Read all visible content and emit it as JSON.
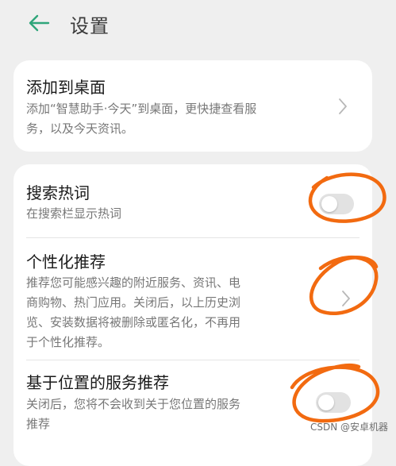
{
  "header": {
    "title": "设置"
  },
  "add_to_desktop": {
    "title": "添加到桌面",
    "desc_line1": "添加“智慧助手·今天”到桌面，更快捷查看服",
    "desc_line2": "务，以及今天资讯。"
  },
  "search_hotwords": {
    "title": "搜索热词",
    "desc": "在搜索栏显示热词",
    "enabled": false
  },
  "personalized": {
    "title": "个性化推荐",
    "desc_line1": "推荐您可能感兴趣的附近服务、资讯、电",
    "desc_line2": "商购物、热门应用。关闭后，以上历史浏",
    "desc_line3": "览、安装数据将被删除或匿名化，不再用",
    "desc_line4": "于个性化推荐。"
  },
  "location_service": {
    "title": "基于位置的服务推荐",
    "desc_line1": "关闭后，您将不会收到关于您位置的服务",
    "desc_line2": "推荐",
    "enabled": false
  },
  "colors": {
    "accent_green": "#2fa57a",
    "scribble_orange": "#f26a10",
    "background": "#efefef",
    "card": "#ffffff"
  },
  "watermark": "CSDN @安卓机器"
}
